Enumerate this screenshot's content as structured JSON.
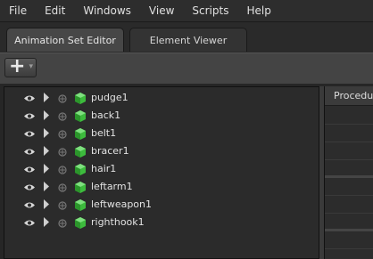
{
  "menu": [
    "File",
    "Edit",
    "Windows",
    "View",
    "Scripts",
    "Help"
  ],
  "tabs": {
    "active": "Animation Set Editor",
    "inactive": "Element Viewer"
  },
  "toolbar": {
    "add_symbol": "+",
    "dropdown_symbol": "▾"
  },
  "tree": {
    "items": [
      {
        "label": "pudge1",
        "icon": "cube-icon"
      },
      {
        "label": "back1",
        "icon": "cube-icon"
      },
      {
        "label": "belt1",
        "icon": "cube-icon"
      },
      {
        "label": "bracer1",
        "icon": "cube-icon"
      },
      {
        "label": "hair1",
        "icon": "cube-icon"
      },
      {
        "label": "leftarm1",
        "icon": "cube-icon"
      },
      {
        "label": "leftweapon1",
        "icon": "cube-icon"
      },
      {
        "label": "righthook1",
        "icon": "cube-icon"
      }
    ]
  },
  "right_panel": {
    "header": "Procedural"
  },
  "colors": {
    "cube_green": "#3dbb3d",
    "background": "#262626"
  }
}
